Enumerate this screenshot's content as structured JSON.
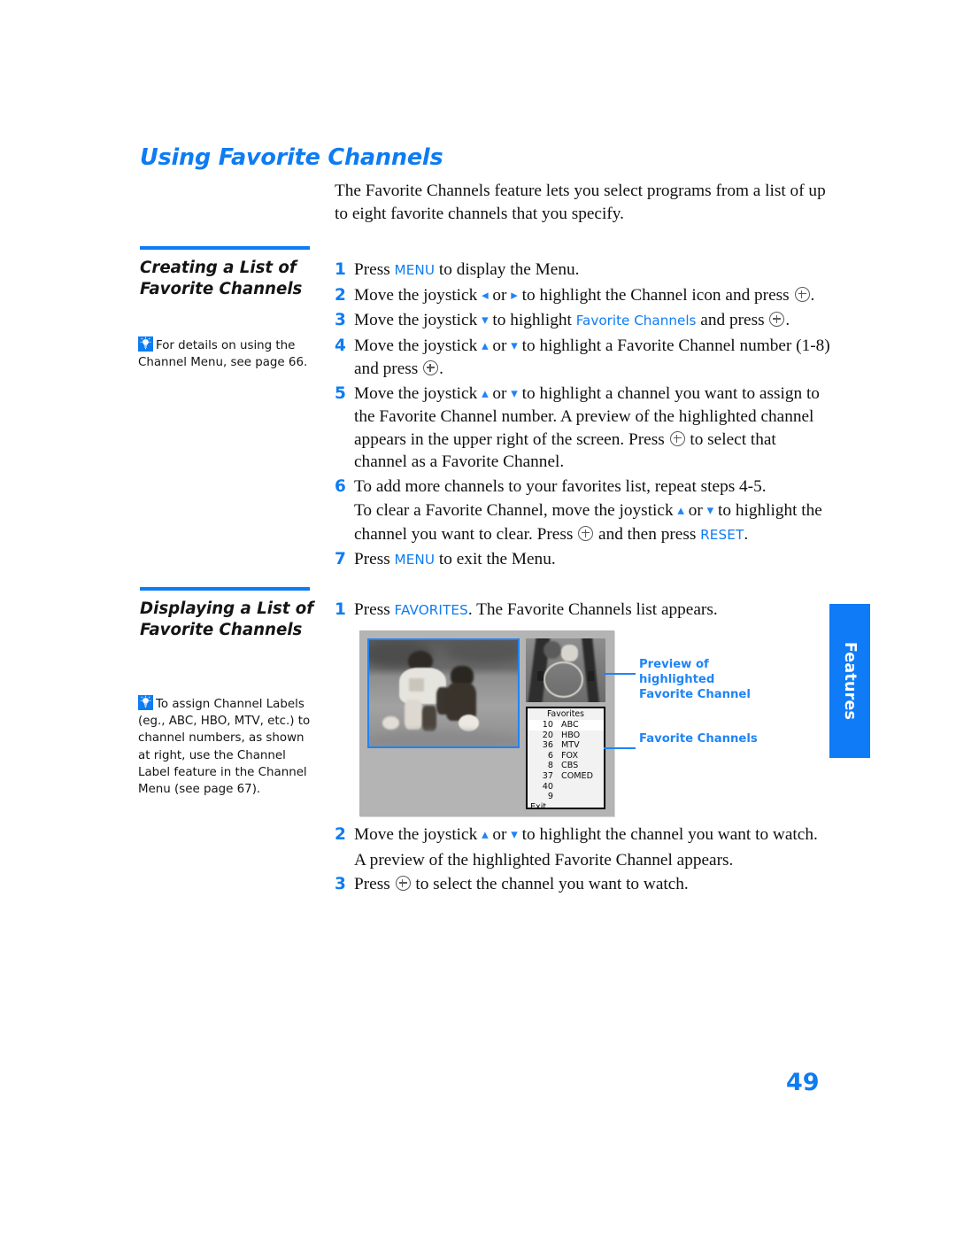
{
  "page": {
    "title": "Using Favorite Channels",
    "intro": "The Favorite Channels feature lets you select programs from a list of up to eight favorite channels that you specify.",
    "page_number": "49",
    "side_tab_label": "Features",
    "accent_color": "#0e7cf2"
  },
  "section1": {
    "heading": "Creating a List of Favorite Channels",
    "tip_icon": "lightbulb-tip-icon",
    "tip": "For details on using the Channel Menu, see page 66.",
    "steps": [
      {
        "num": "1",
        "parts": [
          {
            "t": "text",
            "v": "Press "
          },
          {
            "t": "kw",
            "v": "MENU"
          },
          {
            "t": "text",
            "v": " to display the Menu."
          }
        ]
      },
      {
        "num": "2",
        "parts": [
          {
            "t": "text",
            "v": "Move the joystick "
          },
          {
            "t": "arrow",
            "v": "◂"
          },
          {
            "t": "text",
            "v": " or "
          },
          {
            "t": "arrow",
            "v": "▸"
          },
          {
            "t": "text",
            "v": " to highlight the Channel icon and press "
          },
          {
            "t": "cplus",
            "v": ""
          },
          {
            "t": "text",
            "v": "."
          }
        ]
      },
      {
        "num": "3",
        "parts": [
          {
            "t": "text",
            "v": "Move the joystick "
          },
          {
            "t": "arrow",
            "v": "▾"
          },
          {
            "t": "text",
            "v": " to highlight "
          },
          {
            "t": "kwlc",
            "v": "Favorite Channels"
          },
          {
            "t": "text",
            "v": " and press "
          },
          {
            "t": "cplus",
            "v": ""
          },
          {
            "t": "text",
            "v": "."
          }
        ]
      },
      {
        "num": "4",
        "parts": [
          {
            "t": "text",
            "v": "Move the joystick "
          },
          {
            "t": "arrow",
            "v": "▴"
          },
          {
            "t": "text",
            "v": " or "
          },
          {
            "t": "arrow",
            "v": "▾"
          },
          {
            "t": "text",
            "v": " to highlight a Favorite Channel number (1-8) and press "
          },
          {
            "t": "cplus",
            "v": ""
          },
          {
            "t": "text",
            "v": "."
          }
        ]
      },
      {
        "num": "5",
        "parts": [
          {
            "t": "text",
            "v": "Move the joystick "
          },
          {
            "t": "arrow",
            "v": "▴"
          },
          {
            "t": "text",
            "v": " or "
          },
          {
            "t": "arrow",
            "v": "▾"
          },
          {
            "t": "text",
            "v": " to highlight a channel you want to assign to the Favorite Channel number. A preview of the highlighted channel appears in the upper right of the screen. Press "
          },
          {
            "t": "cplus",
            "v": ""
          },
          {
            "t": "text",
            "v": " to select that channel as a Favorite Channel."
          }
        ]
      },
      {
        "num": "6",
        "parts": [
          {
            "t": "text",
            "v": "To add more channels to your favorites list, repeat steps 4-5."
          }
        ],
        "continuation": [
          {
            "t": "text",
            "v": "To clear a Favorite Channel, move the joystick "
          },
          {
            "t": "arrow",
            "v": "▴"
          },
          {
            "t": "text",
            "v": " or "
          },
          {
            "t": "arrow",
            "v": "▾"
          },
          {
            "t": "text",
            "v": " to highlight the channel you want to clear. Press "
          },
          {
            "t": "cplus",
            "v": ""
          },
          {
            "t": "text",
            "v": " and then press "
          },
          {
            "t": "kw",
            "v": "RESET"
          },
          {
            "t": "text",
            "v": "."
          }
        ]
      },
      {
        "num": "7",
        "parts": [
          {
            "t": "text",
            "v": "Press "
          },
          {
            "t": "kw",
            "v": "MENU"
          },
          {
            "t": "text",
            "v": " to exit the Menu."
          }
        ]
      }
    ]
  },
  "section2": {
    "heading": "Displaying a List of Favorite Channels",
    "tip_icon": "lightbulb-tip-icon",
    "tip": "To assign Channel Labels (eg., ABC, HBO, MTV, etc.) to channel numbers, as shown at right, use the Channel Label feature in the Channel Menu (see page 67).",
    "steps": [
      {
        "num": "1",
        "parts": [
          {
            "t": "text",
            "v": "Press "
          },
          {
            "t": "kw",
            "v": "FAVORITES"
          },
          {
            "t": "text",
            "v": ". The Favorite Channels list appears."
          }
        ]
      },
      {
        "num": "2",
        "parts": [
          {
            "t": "text",
            "v": "Move the joystick "
          },
          {
            "t": "arrow",
            "v": "▴"
          },
          {
            "t": "text",
            "v": " or "
          },
          {
            "t": "arrow",
            "v": "▾"
          },
          {
            "t": "text",
            "v": " to highlight the channel you want to watch."
          }
        ],
        "continuation": [
          {
            "t": "text",
            "v": "A preview of the highlighted Favorite Channel appears."
          }
        ]
      },
      {
        "num": "3",
        "parts": [
          {
            "t": "text",
            "v": "Press "
          },
          {
            "t": "cplus",
            "v": ""
          },
          {
            "t": "text",
            "v": " to select the channel you want to watch."
          }
        ]
      }
    ]
  },
  "figure": {
    "favorites_title": "Favorites",
    "rows": [
      {
        "num": "10",
        "label": "ABC",
        "highlighted": true
      },
      {
        "num": "20",
        "label": "HBO",
        "highlighted": false
      },
      {
        "num": "36",
        "label": "MTV",
        "highlighted": false
      },
      {
        "num": "6",
        "label": "FOX",
        "highlighted": false
      },
      {
        "num": "8",
        "label": "CBS",
        "highlighted": false
      },
      {
        "num": "37",
        "label": "COMED",
        "highlighted": false
      },
      {
        "num": "40",
        "label": "",
        "highlighted": false
      },
      {
        "num": "9",
        "label": "",
        "highlighted": false
      }
    ],
    "exit_label": "Exit",
    "callout_preview": "Preview of highlighted Favorite Channel",
    "callout_list": "Favorite Channels"
  }
}
